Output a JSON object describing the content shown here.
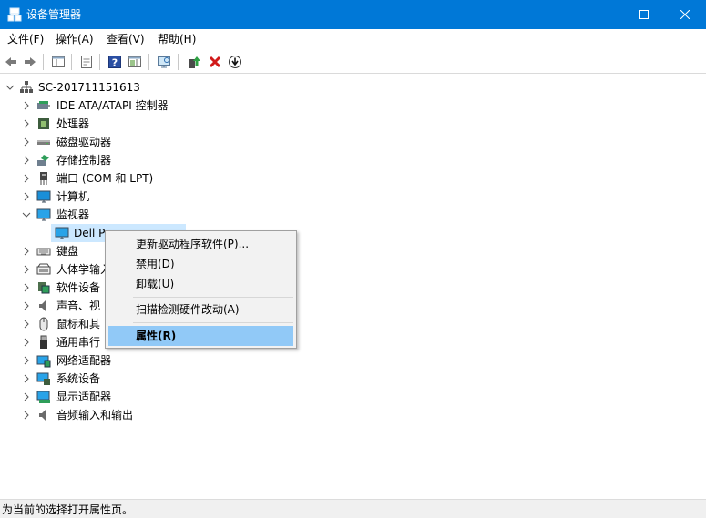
{
  "window": {
    "title": "设备管理器",
    "accent": "#0078d7"
  },
  "menubar": {
    "items": [
      {
        "label": "文件(F)"
      },
      {
        "label": "操作(A)"
      },
      {
        "label": "查看(V)"
      },
      {
        "label": "帮助(H)"
      }
    ]
  },
  "toolbar": {
    "buttons": [
      "back-icon",
      "forward-icon",
      "show-hide-console-tree-icon",
      "properties-icon",
      "help-icon",
      "action-pane-icon",
      "scan-hardware-icon",
      "update-driver-icon",
      "uninstall-icon",
      "disable-icon"
    ]
  },
  "tree": {
    "root": "SC-201711151613",
    "categories": [
      {
        "label": "IDE ATA/ATAPI 控制器",
        "icon": "ide-controller-icon"
      },
      {
        "label": "处理器",
        "icon": "processor-icon"
      },
      {
        "label": "磁盘驱动器",
        "icon": "disk-drive-icon"
      },
      {
        "label": "存储控制器",
        "icon": "storage-controller-icon"
      },
      {
        "label": "端口 (COM 和 LPT)",
        "icon": "port-icon"
      },
      {
        "label": "计算机",
        "icon": "computer-icon"
      },
      {
        "label": "监视器",
        "icon": "monitor-icon",
        "expanded": true
      },
      {
        "label": "键盘",
        "icon": "keyboard-icon"
      },
      {
        "label": "人体学输入",
        "icon": "hid-icon"
      },
      {
        "label": "软件设备",
        "icon": "software-device-icon"
      },
      {
        "label": "声音、视",
        "icon": "sound-icon"
      },
      {
        "label": "鼠标和其",
        "icon": "mouse-icon"
      },
      {
        "label": "通用串行",
        "icon": "usb-icon"
      },
      {
        "label": "网络适配器",
        "icon": "network-adapter-icon"
      },
      {
        "label": "系统设备",
        "icon": "system-device-icon"
      },
      {
        "label": "显示适配器",
        "icon": "display-adapter-icon"
      },
      {
        "label": "音频输入和输出",
        "icon": "audio-io-icon"
      }
    ],
    "selected_child": {
      "label": "Dell P",
      "icon": "monitor-icon"
    }
  },
  "context_menu": {
    "items": [
      {
        "label": "更新驱动程序软件(P)..."
      },
      {
        "label": "禁用(D)"
      },
      {
        "label": "卸载(U)"
      },
      {
        "label": "扫描检测硬件改动(A)"
      },
      {
        "label": "属性(R)"
      }
    ],
    "hover_color": "#91c9f7"
  },
  "statusbar": {
    "text": "为当前的选择打开属性页。"
  }
}
